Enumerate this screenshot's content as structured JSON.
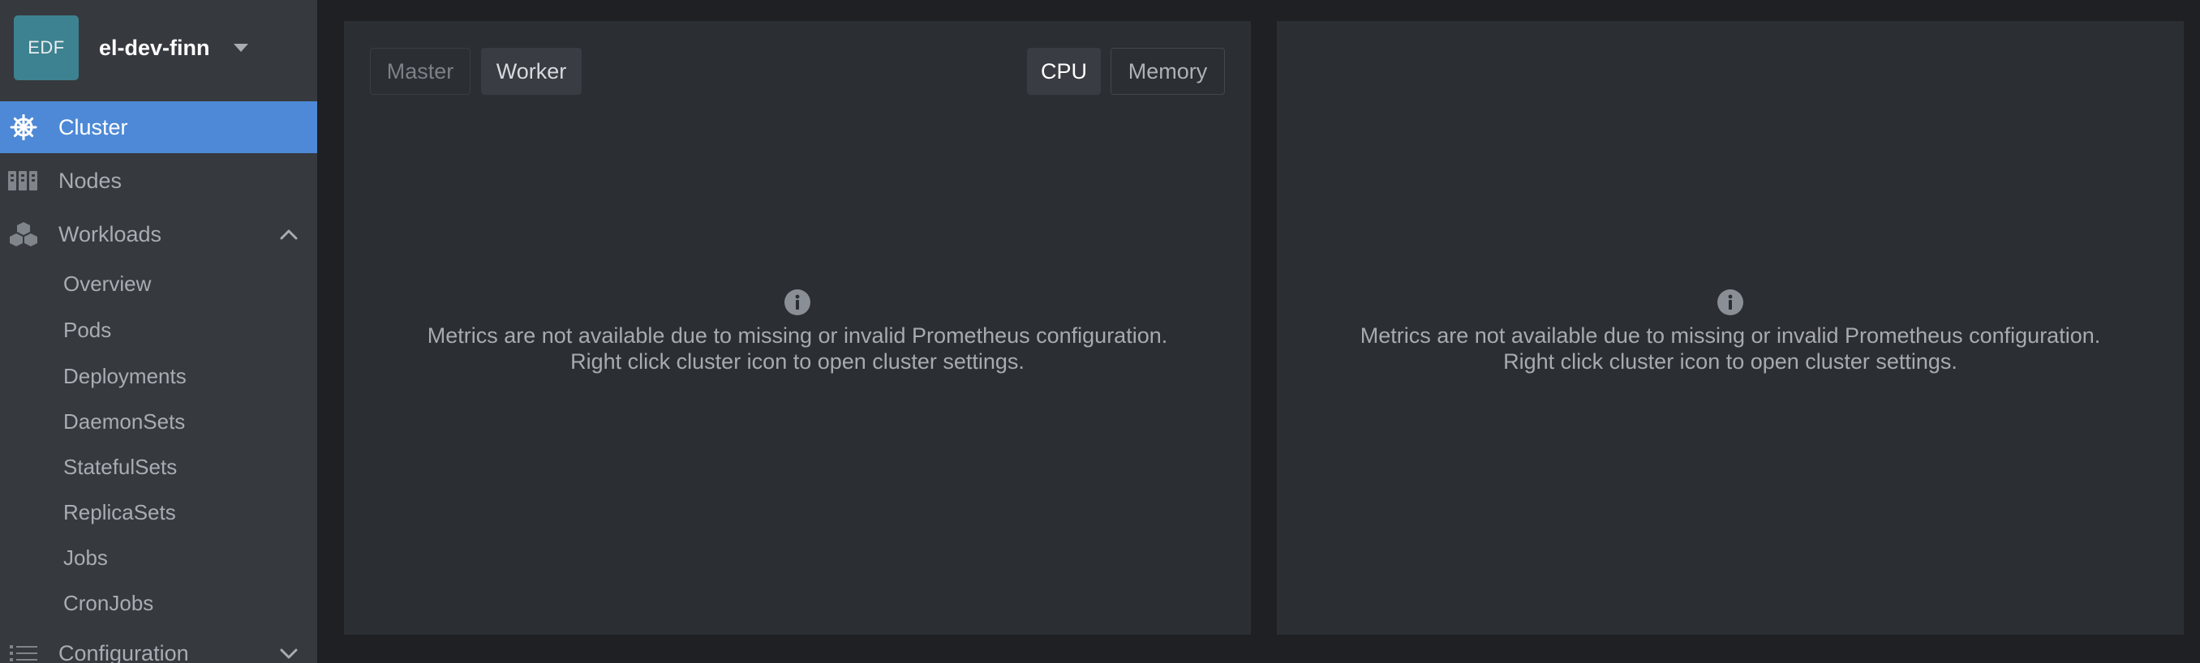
{
  "sidebar": {
    "cluster": {
      "avatar_text": "EDF",
      "name": "el-dev-finn"
    },
    "items": {
      "cluster": {
        "label": "Cluster",
        "icon": "helm-wheel-icon",
        "active": true
      },
      "nodes": {
        "label": "Nodes",
        "icon": "nodes-icon"
      },
      "workloads": {
        "label": "Workloads",
        "icon": "cubes-icon",
        "expanded": true
      },
      "configuration": {
        "label": "Configuration",
        "icon": "list-icon",
        "expanded": false
      }
    },
    "workloads_children": [
      "Overview",
      "Pods",
      "Deployments",
      "DaemonSets",
      "StatefulSets",
      "ReplicaSets",
      "Jobs",
      "CronJobs"
    ]
  },
  "left_panel": {
    "node_tabs": [
      "Master",
      "Worker"
    ],
    "metric_tabs": [
      "CPU",
      "Memory"
    ],
    "selected_metric": "CPU",
    "notice_line1": "Metrics are not available due to missing or invalid Prometheus configuration.",
    "notice_line2": "Right click cluster icon to open cluster settings."
  },
  "right_panel": {
    "notice_line1": "Metrics are not available due to missing or invalid Prometheus configuration.",
    "notice_line2": "Right click cluster icon to open cluster settings."
  },
  "colors": {
    "accent": "#4d89d6",
    "avatar": "#3d8290",
    "sidebar_bg": "#36393e",
    "panel_bg": "#2b2e33",
    "page_bg": "#1e2023"
  }
}
